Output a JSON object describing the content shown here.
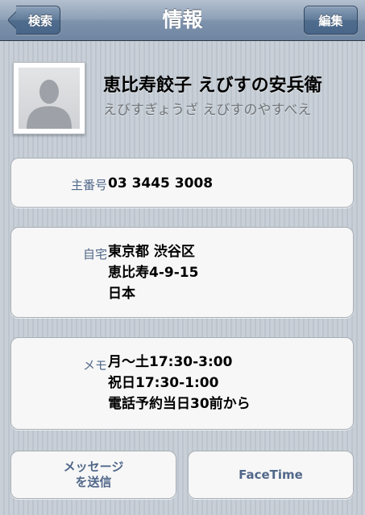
{
  "nav": {
    "back_label": "検索",
    "title": "情報",
    "edit_label": "編集"
  },
  "contact": {
    "name": "恵比寿餃子 えびすの安兵衛",
    "reading": "えびすぎょうざ えびすのやすべえ"
  },
  "phone": {
    "label": "主番号",
    "value": "03 3445 3008"
  },
  "address": {
    "label": "自宅",
    "lines": [
      "東京都 渋谷区",
      "恵比寿4-9-15",
      "日本"
    ]
  },
  "memo": {
    "label": "メモ",
    "lines": [
      "月〜土17:30-3:00",
      "祝日17:30-1:00",
      "電話予約当日30前から"
    ]
  },
  "actions": {
    "message_lines": [
      "メッセージ",
      "を送信"
    ],
    "facetime_label": "FaceTime"
  },
  "icons": {
    "avatar": "person-silhouette-icon",
    "back": "back-chevron-icon"
  },
  "colors": {
    "nav_bar": "#7e93ac",
    "label_blue": "#51688a",
    "background": "#c5ccd4"
  }
}
